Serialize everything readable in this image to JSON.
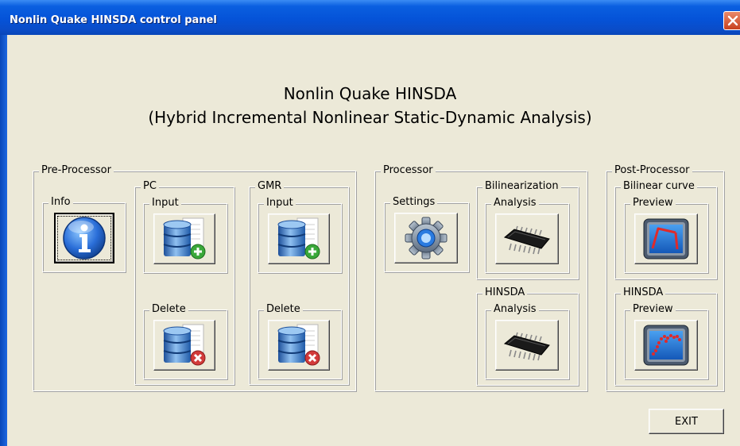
{
  "window": {
    "title": "Nonlin Quake HINSDA control panel",
    "close_icon": "close-icon"
  },
  "heading": {
    "line1": "Nonlin Quake HINSDA",
    "line2": "(Hybrid Incremental Nonlinear Static-Dynamic Analysis)"
  },
  "pre": {
    "label": "Pre-Processor",
    "info": {
      "label": "Info",
      "icon": "info-icon"
    },
    "pc": {
      "label": "PC",
      "input": {
        "label": "Input",
        "icon": "database-add-icon"
      },
      "delete": {
        "label": "Delete",
        "icon": "database-delete-icon"
      }
    },
    "gmr": {
      "label": "GMR",
      "input": {
        "label": "Input",
        "icon": "database-add-icon"
      },
      "delete": {
        "label": "Delete",
        "icon": "database-delete-icon"
      }
    }
  },
  "proc": {
    "label": "Processor",
    "settings": {
      "label": "Settings",
      "icon": "gear-icon"
    },
    "bilin": {
      "label": "Bilinearization",
      "analysis": {
        "label": "Analysis",
        "icon": "chip-icon"
      }
    },
    "hinsda": {
      "label": "HINSDA",
      "analysis": {
        "label": "Analysis",
        "icon": "chip-icon"
      }
    }
  },
  "post": {
    "label": "Post-Processor",
    "bilin": {
      "label": "Bilinear curve",
      "preview": {
        "label": "Preview",
        "icon": "curve-monitor-icon"
      }
    },
    "hinsda": {
      "label": "HINSDA",
      "preview": {
        "label": "Preview",
        "icon": "scatter-monitor-icon"
      }
    }
  },
  "exit_label": "EXIT",
  "colors": {
    "titlebar": "#0553d8",
    "face": "#ece9d8",
    "db_blue": "#3a78c8",
    "add_green": "#3aa83a",
    "del_red": "#d23a3a"
  }
}
